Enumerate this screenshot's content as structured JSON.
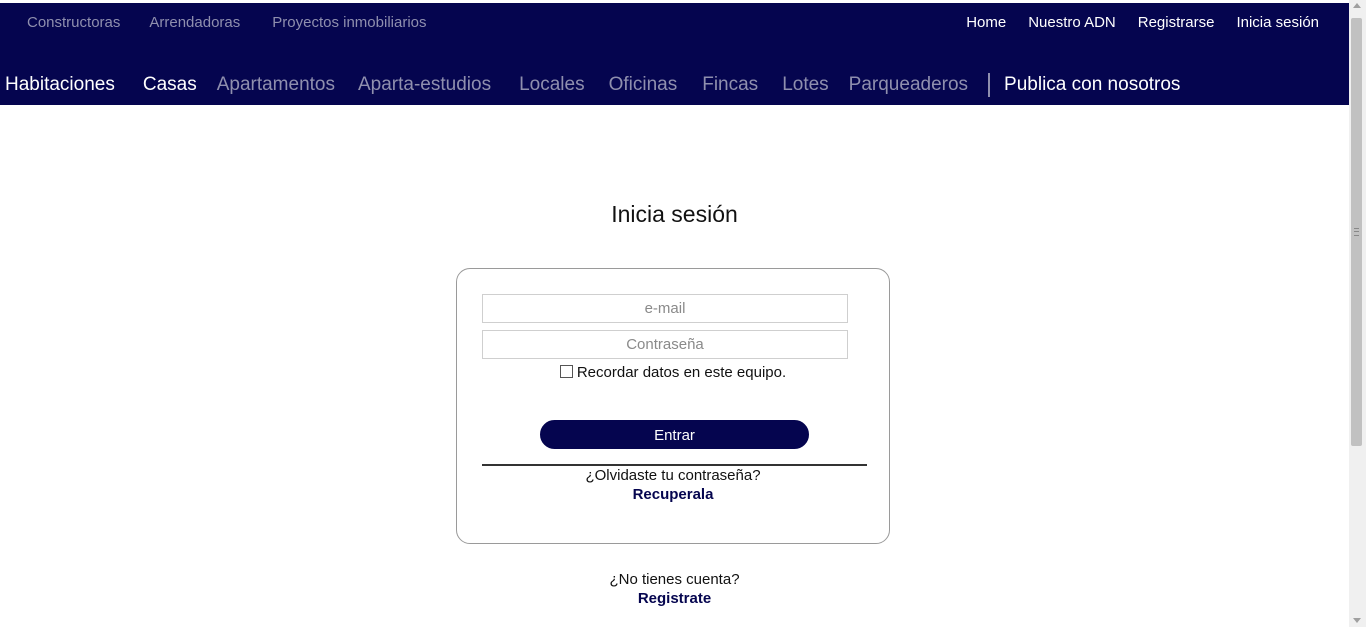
{
  "header": {
    "top_left_links": [
      "Constructoras",
      "Arrendadoras",
      "Proyectos inmobiliarios"
    ],
    "top_right_links": [
      "Home",
      "Nuestro ADN",
      "Registrarse",
      "Inicia sesión"
    ],
    "categories": [
      "Habitaciones",
      "Casas",
      "Apartamentos",
      "Aparta-estudios",
      "Locales",
      "Oficinas",
      "Fincas",
      "Lotes",
      "Parqueaderos"
    ],
    "publish_label": "Publica con nosotros"
  },
  "login": {
    "title": "Inicia sesión",
    "email_placeholder": "e-mail",
    "password_placeholder": "Contraseña",
    "remember_label": "Recordar datos en este equipo.",
    "remember_checked": false,
    "submit_label": "Entrar",
    "forgot_question": "¿Olvidaste tu contraseña?",
    "forgot_link": "Recuperala"
  },
  "footer": {
    "no_account": "¿No tienes cuenta?",
    "register_link": "Registrate"
  },
  "colors": {
    "brand_navy": "#05054f",
    "muted_nav": "#8f8fae"
  }
}
